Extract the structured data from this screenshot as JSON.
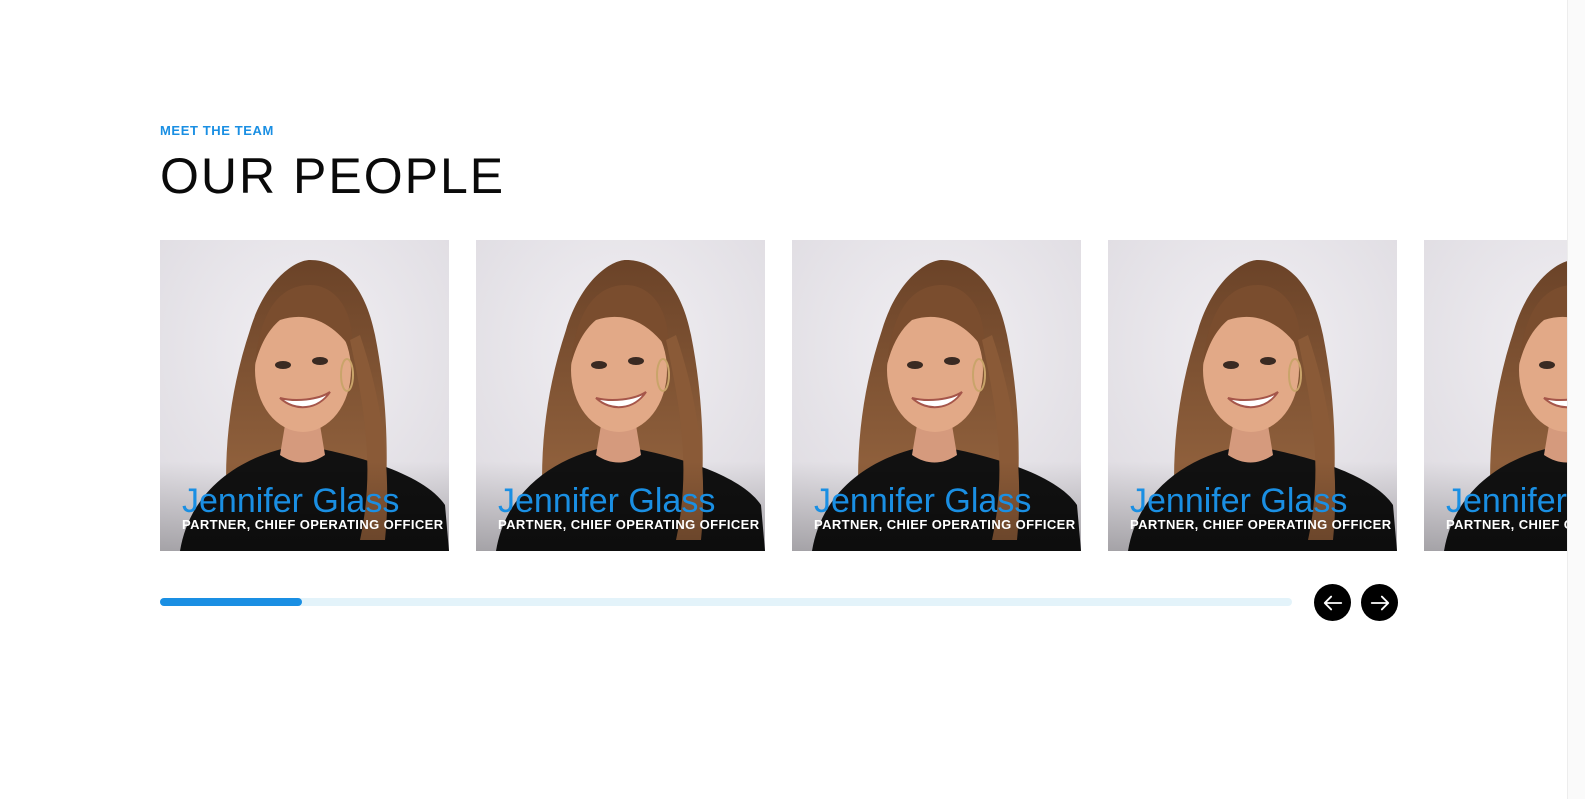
{
  "section": {
    "eyebrow": "MEET THE TEAM",
    "title": "OUR PEOPLE"
  },
  "team": [
    {
      "name": "Jennifer Glass",
      "role": "PARTNER, CHIEF OPERATING OFFICER"
    },
    {
      "name": "Jennifer Glass",
      "role": "PARTNER, CHIEF OPERATING OFFICER"
    },
    {
      "name": "Jennifer Glass",
      "role": "PARTNER, CHIEF OPERATING OFFICER"
    },
    {
      "name": "Jennifer Glass",
      "role": "PARTNER, CHIEF OPERATING OFFICER"
    },
    {
      "name": "Jennifer Glass",
      "role": "PARTNER, CHIEF OPERATING OFFICER"
    }
  ],
  "carousel": {
    "progress_fraction": 0.125,
    "prev_icon": "arrow-left-icon",
    "next_icon": "arrow-right-icon"
  },
  "colors": {
    "accent": "#1a8fe3",
    "track": "#e3f3fa",
    "heading": "#0a0a0a",
    "button": "#000000"
  }
}
